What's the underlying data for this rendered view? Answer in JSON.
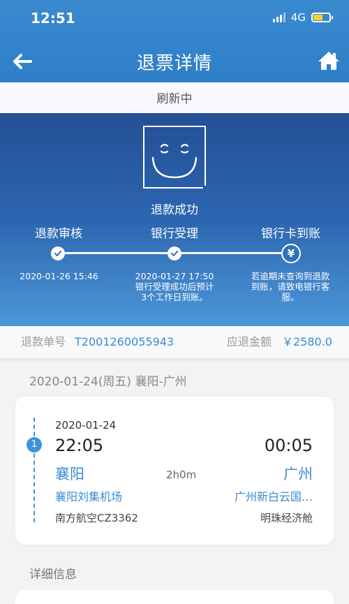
{
  "status_bar": {
    "time": "12:51",
    "network": "4G"
  },
  "nav": {
    "title": "退票详情"
  },
  "refresh": {
    "text": "刷新中"
  },
  "refund": {
    "status": "退款成功",
    "steps": [
      {
        "label": "退款审核",
        "time": "2020-01-26 15:46",
        "desc": ""
      },
      {
        "label": "银行受理",
        "time": "2020-01-27 17:50",
        "desc": "银行受理成功后预计3个工作日到账。"
      },
      {
        "label": "银行卡到账",
        "time": "",
        "desc": "若逾期未查询到退款到账，请致电银行客服。",
        "icon": "¥"
      }
    ],
    "order_label": "退款单号",
    "order_no": "T2001260055943",
    "amount_label": "应退金额",
    "amount": "￥2580.0"
  },
  "trip": {
    "header": "2020-01-24(周五) 襄阳-广州",
    "segment_no": "1",
    "date": "2020-01-24",
    "depart_time": "22:05",
    "arrive_time": "00:05",
    "depart_city": "襄阳",
    "arrive_city": "广州",
    "duration": "2h0m",
    "depart_airport": "襄阳刘集机场",
    "arrive_airport": "广州新白云国…",
    "flight": "南方航空CZ3362",
    "cabin": "明珠经济舱"
  },
  "detail": {
    "title": "详细信息"
  },
  "colors": {
    "nav_bg": "#2e7fc8",
    "accent": "#3b8bd3",
    "panel_top": "#244f95",
    "panel_bottom": "#4d97d8"
  }
}
